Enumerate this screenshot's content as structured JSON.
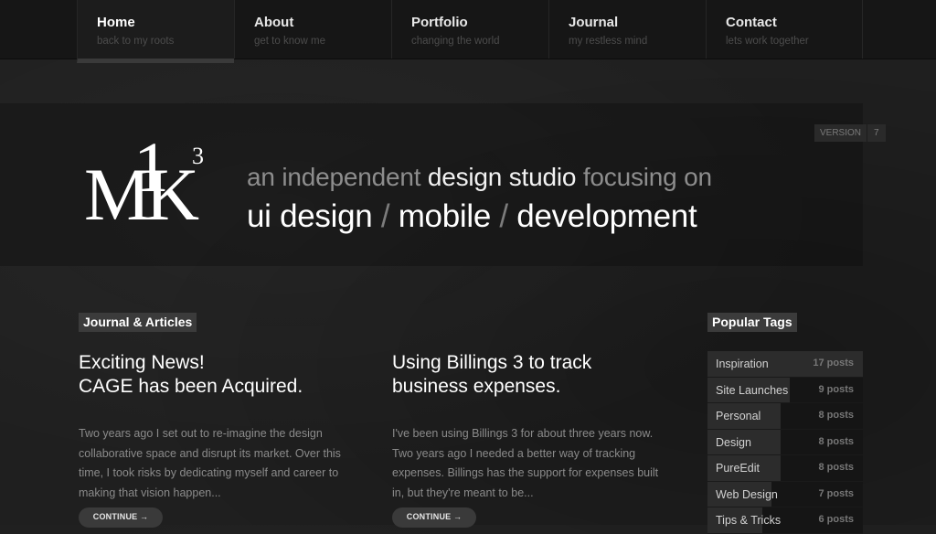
{
  "nav": {
    "items": [
      {
        "title": "Home",
        "subtitle": "back to my roots"
      },
      {
        "title": "About",
        "subtitle": "get to know me"
      },
      {
        "title": "Portfolio",
        "subtitle": "changing the world"
      },
      {
        "title": "Journal",
        "subtitle": "my restless mind"
      },
      {
        "title": "Contact",
        "subtitle": "lets work together"
      }
    ]
  },
  "version": {
    "label": "VERSION",
    "number": "7"
  },
  "logo": {
    "letters_m_k": "MK",
    "one": "1",
    "three": "3"
  },
  "hero": {
    "line1_part1": "an independent ",
    "line1_highlight": "design studio",
    "line1_part2": " focusing on",
    "line2_item1": "ui design",
    "line2_sep": " / ",
    "line2_item2": "mobile",
    "line2_item3": "development"
  },
  "journal": {
    "label": "Journal & Articles",
    "articles": [
      {
        "title_line1": "Exciting News!",
        "title_line2": "CAGE has been Acquired.",
        "excerpt": "Two years ago I set out to re-imagine the design collaborative space and disrupt its market. Over this time, I took risks by dedicating myself and career to making that vision happen...",
        "continue": "CONTINUE →"
      },
      {
        "title_line1": "Using Billings 3 to track",
        "title_line2": "business expenses.",
        "excerpt": "I've been using Billings 3 for about three years now. Two years ago I needed a better way of tracking expenses. Billings has the support for expenses built in, but they're meant to be...",
        "continue": "CONTINUE →"
      }
    ]
  },
  "tags": {
    "label": "Popular Tags",
    "items": [
      {
        "name": "Inspiration",
        "count": "17 posts",
        "fill": 1.0
      },
      {
        "name": "Site Launches",
        "count": "9 posts",
        "fill": 0.53
      },
      {
        "name": "Personal",
        "count": "8 posts",
        "fill": 0.47
      },
      {
        "name": "Design",
        "count": "8 posts",
        "fill": 0.47
      },
      {
        "name": "PureEdit",
        "count": "8 posts",
        "fill": 0.47
      },
      {
        "name": "Web Design",
        "count": "7 posts",
        "fill": 0.41
      },
      {
        "name": "Tips & Tricks",
        "count": "6 posts",
        "fill": 0.35
      }
    ]
  },
  "colors": {
    "background": "#1f1f1f",
    "nav_background": "#161616",
    "label_background": "#3b3b3b",
    "text_primary": "#ffffff",
    "text_muted": "#8b8b8b"
  }
}
